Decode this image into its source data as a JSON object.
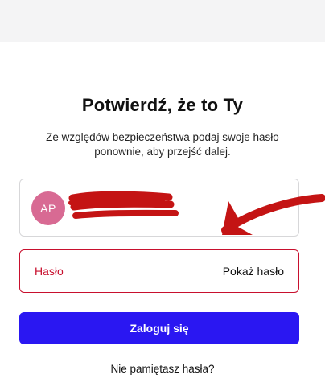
{
  "header": {
    "title": "Potwierdź, że to Ty",
    "subtitle": "Ze względów bezpieczeństwa podaj swoje hasło ponownie, aby przejść dalej."
  },
  "account": {
    "avatar_initials": "AP",
    "avatar_color": "#d86a93",
    "name": "A... P...",
    "email": "..."
  },
  "password": {
    "label": "Hasło",
    "value": "",
    "show_label": "Pokaż hasło",
    "error_color": "#c8102e"
  },
  "actions": {
    "login_label": "Zaloguj się",
    "login_color": "#2a17f2",
    "forgot_label": "Nie pamiętasz hasła?"
  },
  "annotations": {
    "redaction_color": "#c41414",
    "arrow_color": "#c41414"
  }
}
